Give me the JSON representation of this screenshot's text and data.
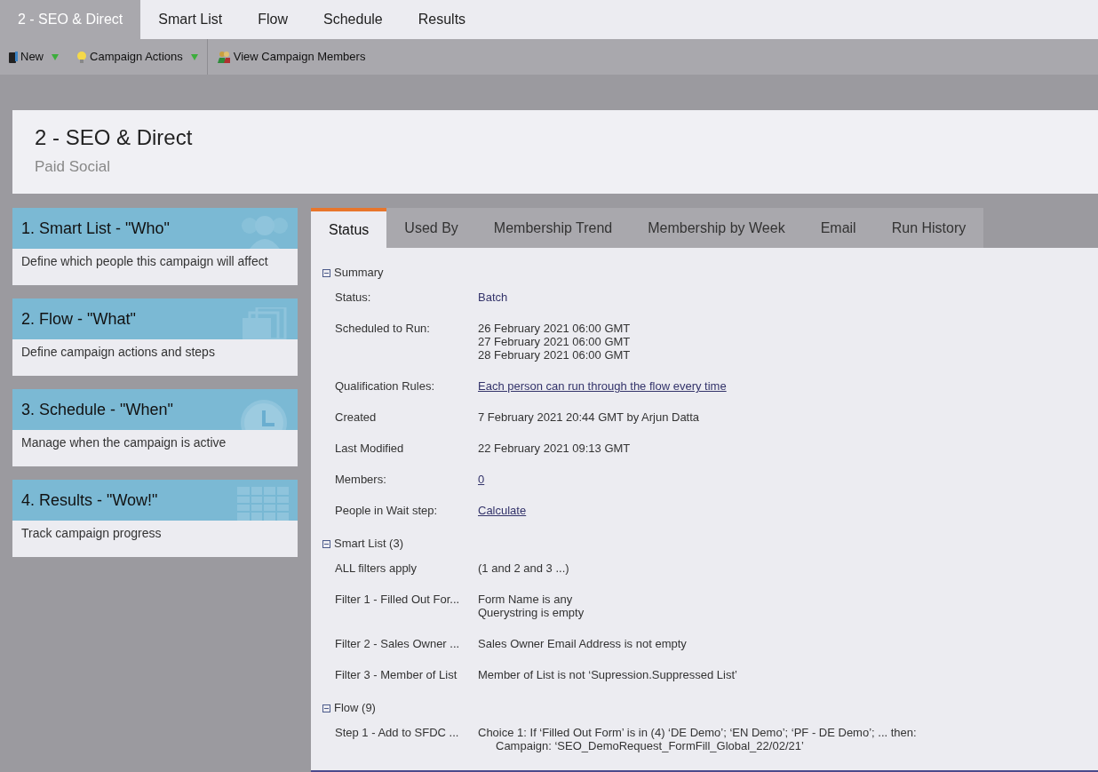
{
  "top_tabs": [
    {
      "label": "2 - SEO & Direct",
      "selected": true
    },
    {
      "label": "Smart List",
      "selected": false
    },
    {
      "label": "Flow",
      "selected": false
    },
    {
      "label": "Schedule",
      "selected": false
    },
    {
      "label": "Results",
      "selected": false
    }
  ],
  "toolbar": [
    {
      "label": "New",
      "dropdown": true
    },
    {
      "label": "Campaign Actions",
      "dropdown": true
    },
    {
      "label": "View Campaign Members",
      "dropdown": false
    }
  ],
  "header": {
    "title": "2 - SEO & Direct",
    "subtitle": "Paid Social"
  },
  "steps": [
    {
      "title": "1. Smart List - \"Who\"",
      "description": "Define which people this campaign will affect"
    },
    {
      "title": "2. Flow - \"What\"",
      "description": "Define campaign actions and steps"
    },
    {
      "title": "3. Schedule - \"When\"",
      "description": "Manage when the campaign is active"
    },
    {
      "title": "4. Results - \"Wow!\"",
      "description": "Track campaign progress"
    }
  ],
  "detail_tabs": [
    {
      "label": "Status",
      "selected": true
    },
    {
      "label": "Used By",
      "selected": false
    },
    {
      "label": "Membership Trend",
      "selected": false
    },
    {
      "label": "Membership by Week",
      "selected": false
    },
    {
      "label": "Email",
      "selected": false
    },
    {
      "label": "Run History",
      "selected": false
    }
  ],
  "sections": [
    {
      "title": "Summary",
      "expanded": true,
      "rows": [
        {
          "label": "Status:",
          "value": [
            "Batch"
          ],
          "kind": "accent"
        },
        {
          "label": "Scheduled to Run:",
          "value": [
            "26 February 2021 06:00 GMT",
            "27 February 2021 06:00 GMT",
            "28 February 2021 06:00 GMT"
          ],
          "kind": "text"
        },
        {
          "label": "Qualification Rules:",
          "value": [
            "Each person can run through the flow every time"
          ],
          "kind": "link"
        },
        {
          "label": "Created",
          "value": [
            "7 February 2021 20:44 GMT by Arjun Datta"
          ],
          "kind": "text"
        },
        {
          "label": "Last Modified",
          "value": [
            "22 February 2021 09:13 GMT"
          ],
          "kind": "text"
        },
        {
          "label": "Members:",
          "value": [
            "0"
          ],
          "kind": "link"
        },
        {
          "label": "People in Wait step:",
          "value": [
            "Calculate"
          ],
          "kind": "link"
        }
      ]
    },
    {
      "title": "Smart List (3)",
      "expanded": true,
      "rows": [
        {
          "label": "ALL filters apply",
          "value": [
            "(1 and 2 and 3 ...)"
          ],
          "kind": "text"
        },
        {
          "label": "Filter 1 - Filled Out For...",
          "value": [
            "Form Name is any",
            "Querystring is empty"
          ],
          "kind": "text"
        },
        {
          "label": "Filter 2 - Sales Owner ...",
          "value": [
            "Sales Owner Email Address is not empty"
          ],
          "kind": "text"
        },
        {
          "label": "Filter 3 - Member of List",
          "value": [
            "Member of List is not ‘Supression.Suppressed List’"
          ],
          "kind": "text"
        }
      ]
    },
    {
      "title": "Flow (9)",
      "expanded": true,
      "rows": [
        {
          "label": "Step 1 - Add to SFDC ...",
          "value": [
            "Choice 1: If ‘Filled Out Form’ is in (4) ‘DE Demo’; ‘EN Demo’; ‘PF - DE Demo’; ... then:",
            "Campaign: ‘SEO_DemoRequest_FormFill_Global_22/02/21’"
          ],
          "kind": "text"
        }
      ]
    }
  ]
}
